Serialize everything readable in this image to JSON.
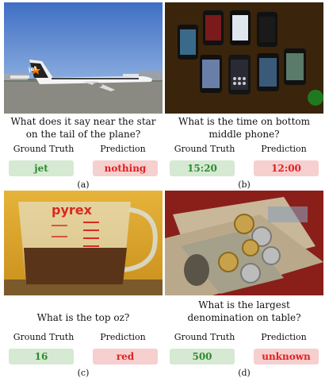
{
  "column_labels": {
    "ground_truth": "Ground Truth",
    "prediction": "Prediction"
  },
  "panels": [
    {
      "question": "What does it say near the star on the tail of the plane?",
      "ground_truth": "jet",
      "prediction": "nothing",
      "caption": "(a)"
    },
    {
      "question": "What is the time on bottom middle phone?",
      "ground_truth": "15:20",
      "prediction": "12:00",
      "caption": "(b)"
    },
    {
      "question": "What is the top oz?",
      "ground_truth": "16",
      "prediction": "red",
      "caption": "(c)"
    },
    {
      "question": "What is the largest denomination on table?",
      "ground_truth": "500",
      "prediction": "unknown",
      "caption": "(d)"
    }
  ],
  "photo_text": {
    "tail_lettering": "jet",
    "cup_brand": "pyrex"
  },
  "colors": {
    "ground_truth_bg": "#d6e9d2",
    "ground_truth_text": "#2f8a2f",
    "prediction_bg": "#f6cfcf",
    "prediction_text": "#e02020"
  }
}
